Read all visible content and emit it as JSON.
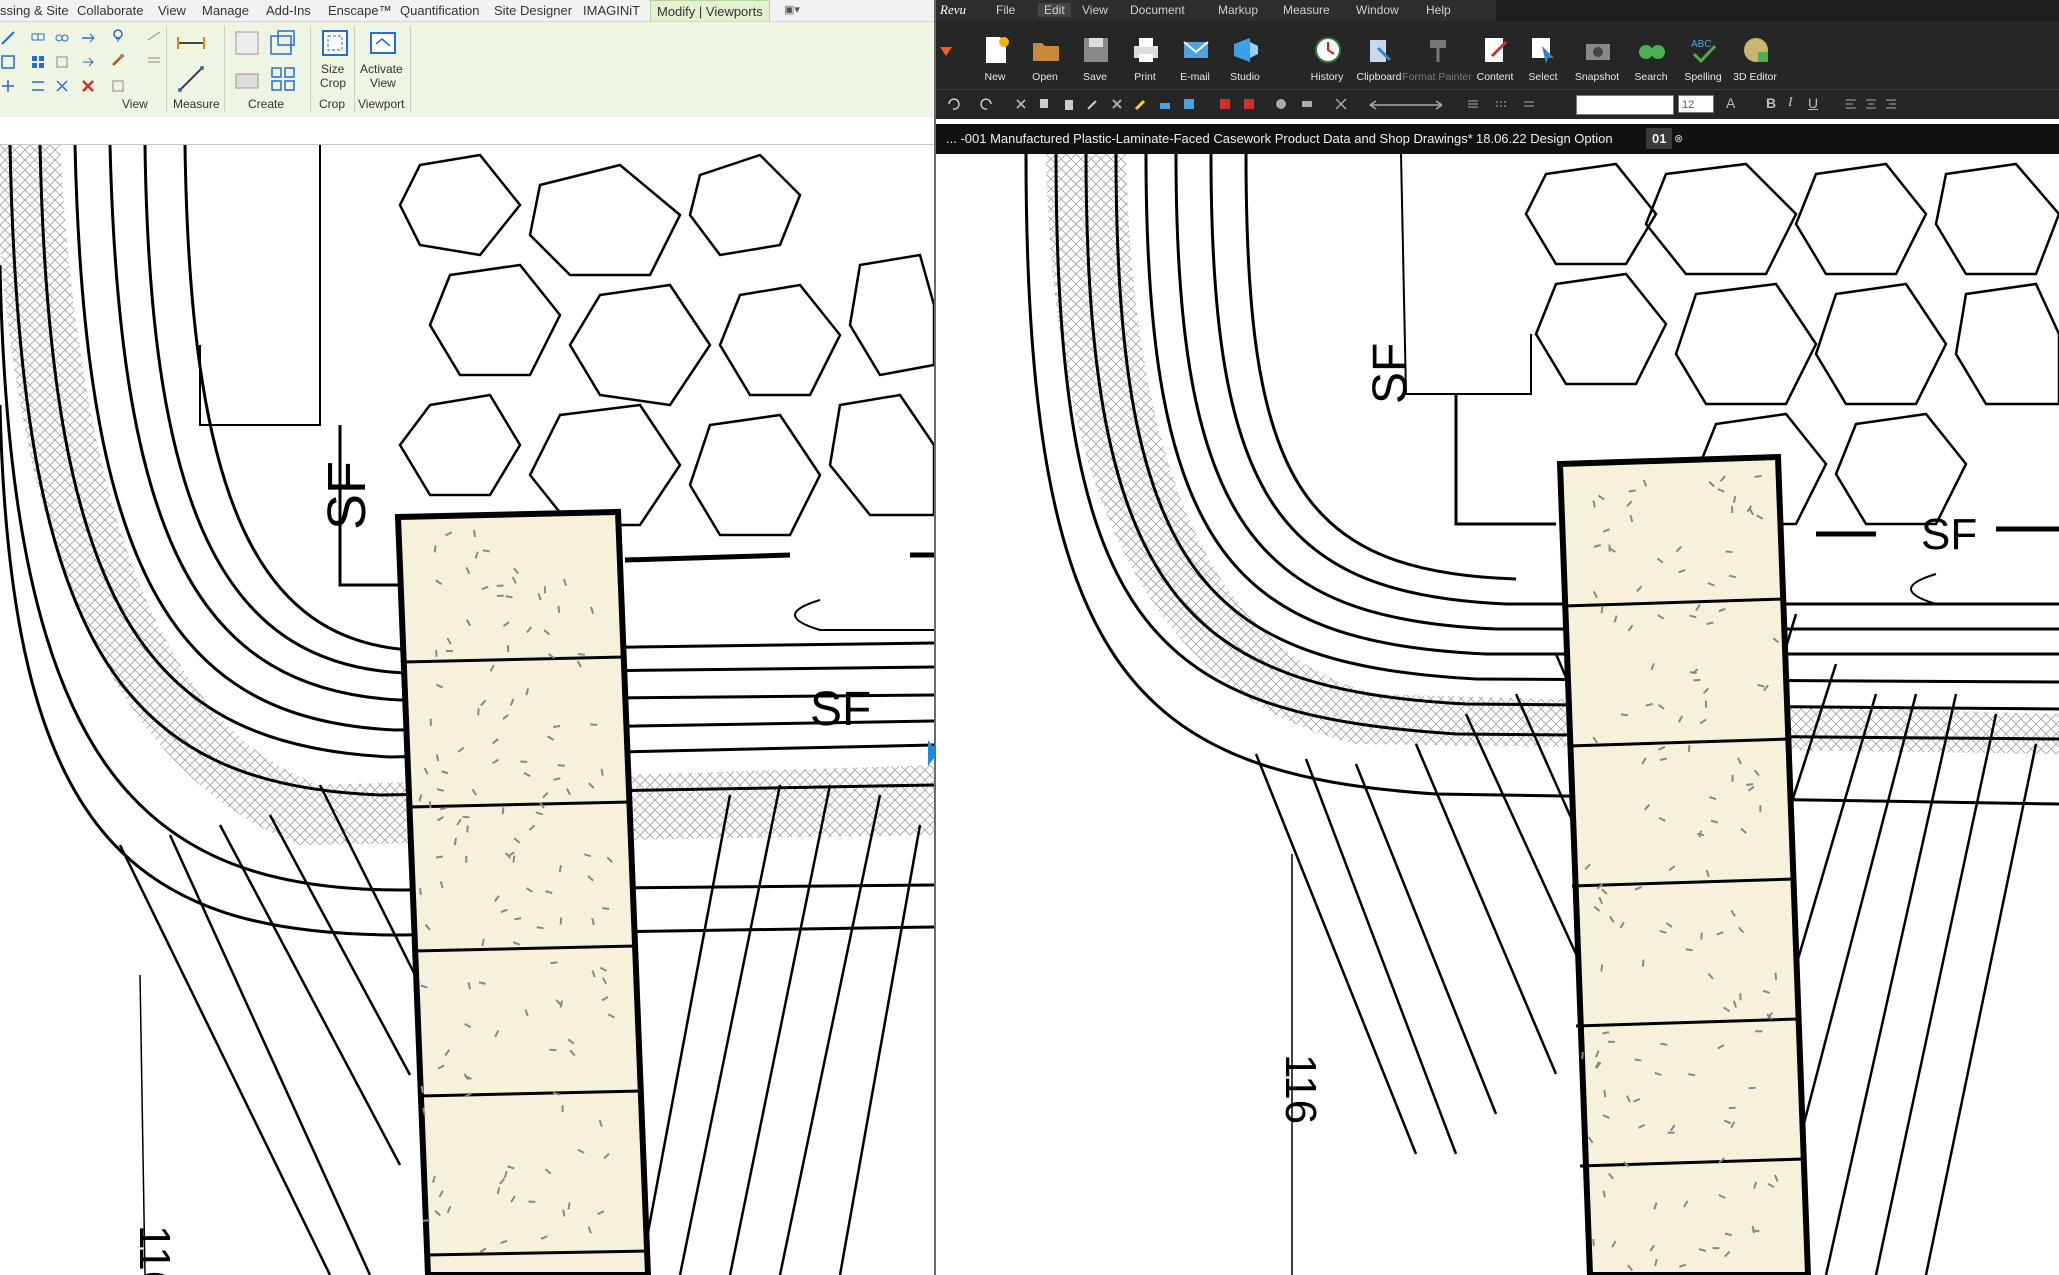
{
  "left_app": {
    "tabs": [
      "ssing & Site",
      "Collaborate",
      "View",
      "Manage",
      "Add-Ins",
      "Enscape™",
      "Quantification",
      "Site Designer",
      "IMAGINiT",
      "Modify | Viewports"
    ],
    "active_tab": "Modify | Viewports",
    "ribbon_groups": {
      "view": "View",
      "measure": "Measure",
      "create": "Create",
      "crop": "Crop",
      "viewport": "Viewport"
    },
    "buttons": {
      "size_crop_line1": "Size",
      "size_crop_line2": "Crop",
      "activate_view_line1": "Activate",
      "activate_view_line2": "View"
    }
  },
  "right_app": {
    "logo": "Revu",
    "menu": [
      "File",
      "Edit",
      "View",
      "Document",
      "Markup",
      "Measure",
      "Window",
      "Help"
    ],
    "toolbar": [
      "New",
      "Open",
      "Save",
      "Print",
      "E-mail",
      "Studio",
      "History",
      "Clipboard",
      "Format Painter",
      "Content",
      "Select",
      "Snapshot",
      "Search",
      "Spelling",
      "3D Editor"
    ],
    "font_size": "12",
    "doc_tabs": {
      "doc1": "... -001 Manufactured Plastic-Laminate-Faced Casework Product Data and Shop Drawings*",
      "doc2": "18.06.22 Design Option",
      "doc3": "01"
    }
  },
  "drawing_labels": {
    "sf": "SF",
    "elevation": "116"
  },
  "colors": {
    "revit_ribbon_bg": "#eef5e3",
    "revu_bg": "#262626",
    "stair_fill": "#f7f1dc",
    "accent_blue": "#1e88e5"
  }
}
